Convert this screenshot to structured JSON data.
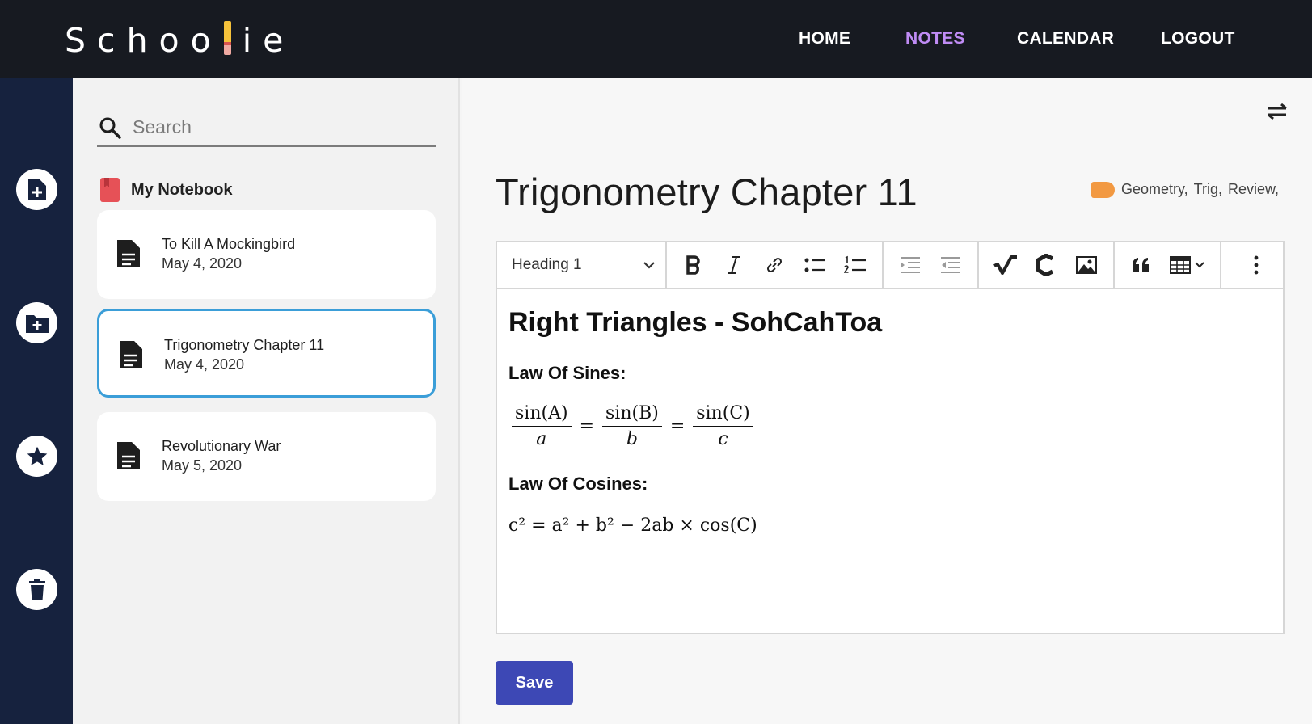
{
  "app": {
    "logo_before": "Schoo",
    "logo_after": "ie"
  },
  "nav": {
    "home": "HOME",
    "notes": "NOTES",
    "calendar": "CALENDAR",
    "logout": "LOGOUT"
  },
  "colors": {
    "topbar": "#171a21",
    "rail": "#16223e",
    "active_nav": "#c08cf5",
    "selected_card_border": "#3b9ed8",
    "save_button": "#3d48b5",
    "tag": "#f29942",
    "notebook_icon": "#e65157"
  },
  "sidebar_icons": [
    "new-note-icon",
    "new-folder-icon",
    "star-icon",
    "trash-icon"
  ],
  "search": {
    "placeholder": "Search"
  },
  "notebook": {
    "title": "My Notebook"
  },
  "notes": [
    {
      "title": "To Kill A Mockingbird",
      "date": "May 4, 2020"
    },
    {
      "title": "Trigonometry Chapter 11",
      "date": "May 4, 2020"
    },
    {
      "title": "Revolutionary War",
      "date": "May 5, 2020"
    }
  ],
  "document": {
    "title": "Trigonometry Chapter 11",
    "tags": [
      "Geometry,",
      "Trig,",
      "Review,"
    ]
  },
  "toolbar": {
    "heading": "Heading 1",
    "buttons": [
      "bold",
      "italic",
      "link",
      "bulleted-list",
      "numbered-list",
      "indent",
      "outdent",
      "math",
      "chemistry",
      "image",
      "quote",
      "table",
      "more"
    ]
  },
  "content": {
    "heading": "Right Triangles - SohCahToa",
    "law_sines_label": "Law Of Sines:",
    "law_cosines_label": "Law Of Cosines:",
    "sines": {
      "n1": "sin(A)",
      "d1": "a",
      "n2": "sin(B)",
      "d2": "b",
      "n3": "sin(C)",
      "d3": "c",
      "eq": "="
    },
    "cosines": "c² = a² + b² − 2ab × cos(C)"
  },
  "save_label": "Save"
}
